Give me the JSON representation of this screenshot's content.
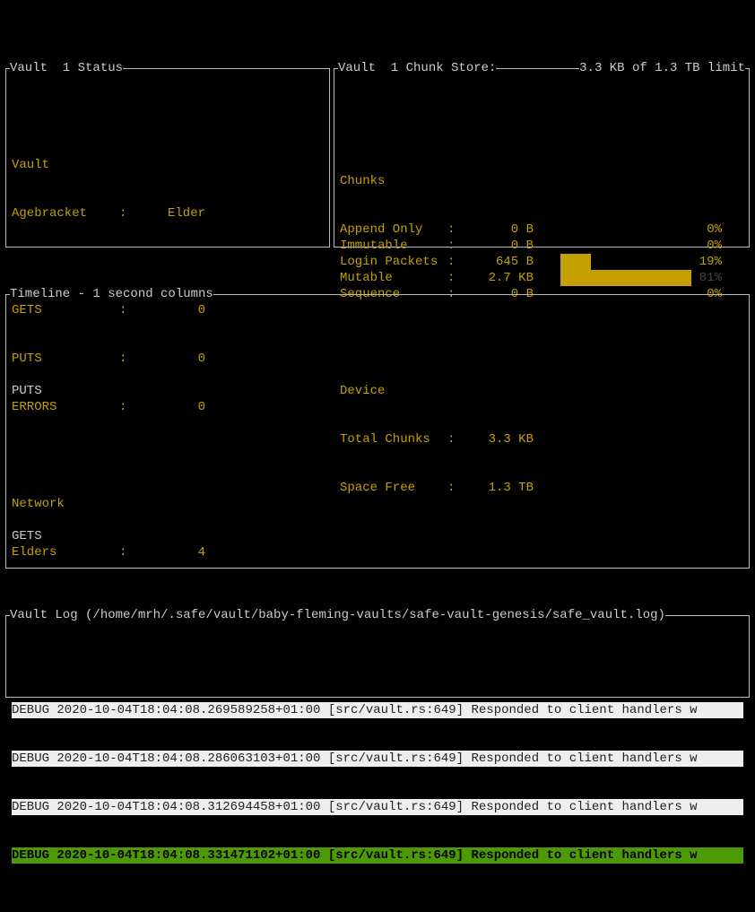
{
  "status": {
    "title_left": "Vault  1 Status",
    "section1_header": "Vault",
    "agebracket_label": "Agebracket",
    "agebracket_value": "Elder",
    "gets_label": "GETS",
    "gets_value": "0",
    "puts_label": "PUTS",
    "puts_value": "0",
    "errors_label": "ERRORS",
    "errors_value": "0",
    "section2_header": "Network",
    "elders_label": "Elders",
    "elders_value": "4"
  },
  "chunk": {
    "title_left": "Vault  1 Chunk Store:",
    "title_right": "3.3 KB of 1.3 TB limit",
    "section1_header": "Chunks",
    "rows": [
      {
        "label": "Append Only",
        "col": ":",
        "value": "0 B",
        "pct": "0%",
        "bar": 0
      },
      {
        "label": "Immutable",
        "col": ":",
        "value": "0 B",
        "pct": "0%",
        "bar": 0
      },
      {
        "label": "Login Packets",
        "col": ":",
        "value": "645 B",
        "pct": "19%",
        "bar": 19
      },
      {
        "label": "Mutable",
        "col": ":",
        "value": "2.7 KB",
        "pct": "81%",
        "bar": 81
      },
      {
        "label": "Sequence",
        "col": ":",
        "value": "0 B",
        "pct": "0%",
        "bar": 0
      }
    ],
    "section2_header": "Device",
    "total_label": "Total Chunks ",
    "total_value": "3.3 KB",
    "free_label": "Space Free",
    "free_value": "1.3 TB"
  },
  "timeline": {
    "title": "Timeline - 1 second columns",
    "labels": [
      "PUTS",
      "GETS",
      "ERRORS"
    ]
  },
  "log": {
    "title": "Vault Log (/home/mrh/.safe/vault/baby-fleming-vaults/safe-vault-genesis/safe_vault.log)",
    "lines": [
      "DEBUG 2020-10-04T18:04:08.269589258+01:00 [src/vault.rs:649] Responded to client handlers w",
      "DEBUG 2020-10-04T18:04:08.286063103+01:00 [src/vault.rs:649] Responded to client handlers w",
      "DEBUG 2020-10-04T18:04:08.312694458+01:00 [src/vault.rs:649] Responded to client handlers w",
      "DEBUG 2020-10-04T18:04:08.331471102+01:00 [src/vault.rs:649] Responded to client handlers w"
    ]
  }
}
